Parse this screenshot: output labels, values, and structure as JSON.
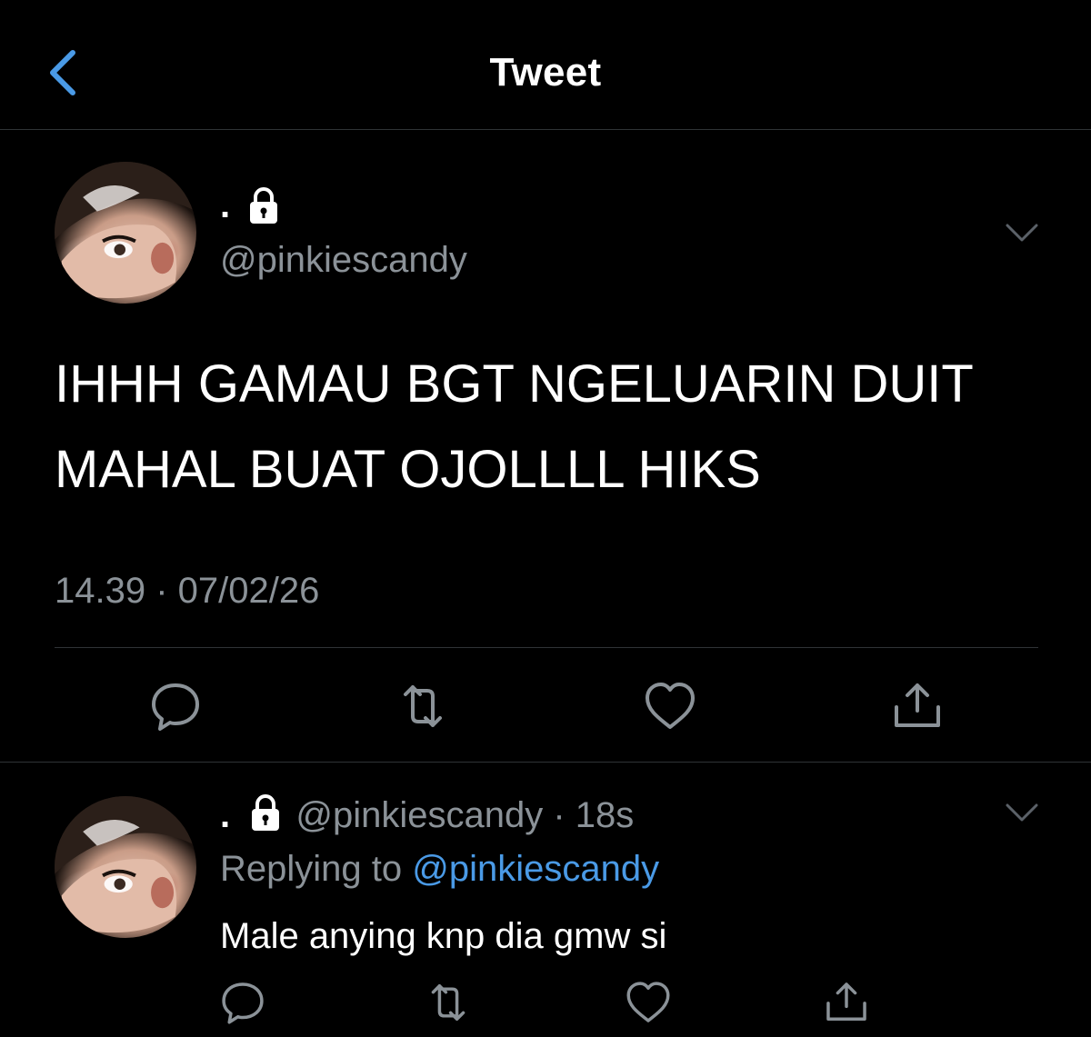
{
  "header": {
    "title": "Tweet",
    "back_icon": "chevron-left-icon"
  },
  "colors": {
    "background": "#000000",
    "accent": "#4a9ae6",
    "secondary_text": "#8b9298",
    "divider": "#2f3336"
  },
  "main_tweet": {
    "display_name": ".",
    "lock_icon": "lock-icon",
    "handle": "@pinkiescandy",
    "text_line1": "IHHH GAMAU BGT NGELUARIN DUIT",
    "text_line2": "MAHAL BUAT OJOLLLL HIKS",
    "time": "14.39",
    "separator": "·",
    "date": "07/02/26",
    "actions": [
      "reply-icon",
      "retweet-icon",
      "like-icon",
      "share-icon"
    ]
  },
  "reply_tweet": {
    "display_name": ".",
    "lock_icon": "lock-icon",
    "handle": "@pinkiescandy",
    "separator": "·",
    "age": "18s",
    "replying_to_label": "Replying to",
    "replying_to_handle": "@pinkiescandy",
    "text": "Male anying knp dia gmw si",
    "actions": [
      "reply-icon",
      "retweet-icon",
      "like-icon",
      "share-icon"
    ]
  }
}
